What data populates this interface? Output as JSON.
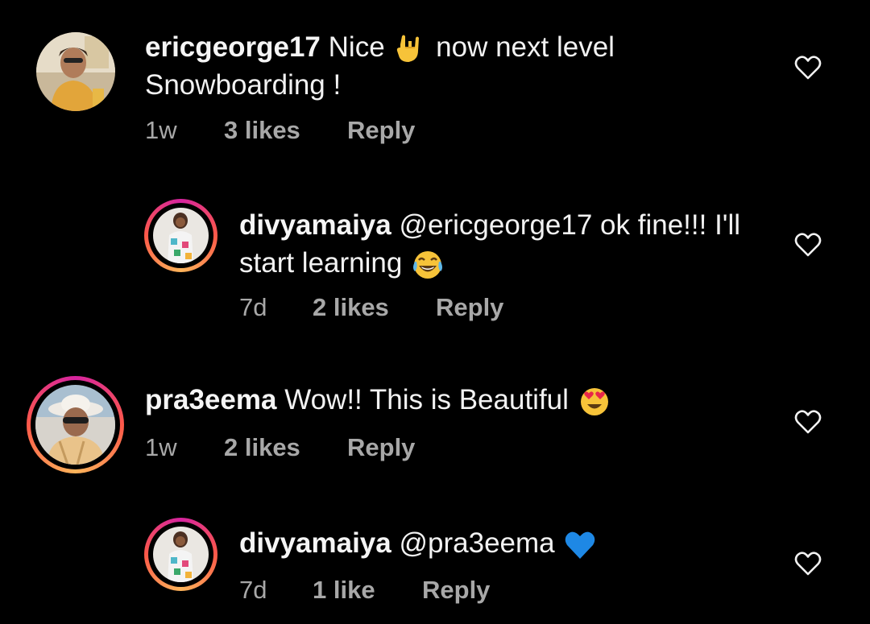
{
  "comments": [
    {
      "username": "ericgeorge17",
      "text_before": "Nice",
      "emoji_1": "rock-on-hand-emoji",
      "text_after": "now next level Snowboarding !",
      "time": "1w",
      "likes": "3 likes",
      "reply": "Reply"
    },
    {
      "username": "divyamaiya",
      "text": "@ericgeorge17 ok fine!!! I'll start learning",
      "emoji": "tears-of-joy-emoji",
      "time": "7d",
      "likes": "2 likes",
      "reply": "Reply"
    },
    {
      "username": "pra3eema",
      "text": "Wow!! This is Beautiful",
      "emoji": "heart-eyes-emoji",
      "time": "1w",
      "likes": "2 likes",
      "reply": "Reply"
    },
    {
      "username": "divyamaiya",
      "text": "@pra3eema",
      "emoji": "blue-heart-emoji",
      "time": "7d",
      "likes": "1 like",
      "reply": "Reply"
    }
  ],
  "colors": {
    "background": "#000000",
    "text": "#f2f2f2",
    "meta": "#a8a8a8",
    "story_ring_start": "#d6249f",
    "story_ring_end": "#fdb45a"
  }
}
